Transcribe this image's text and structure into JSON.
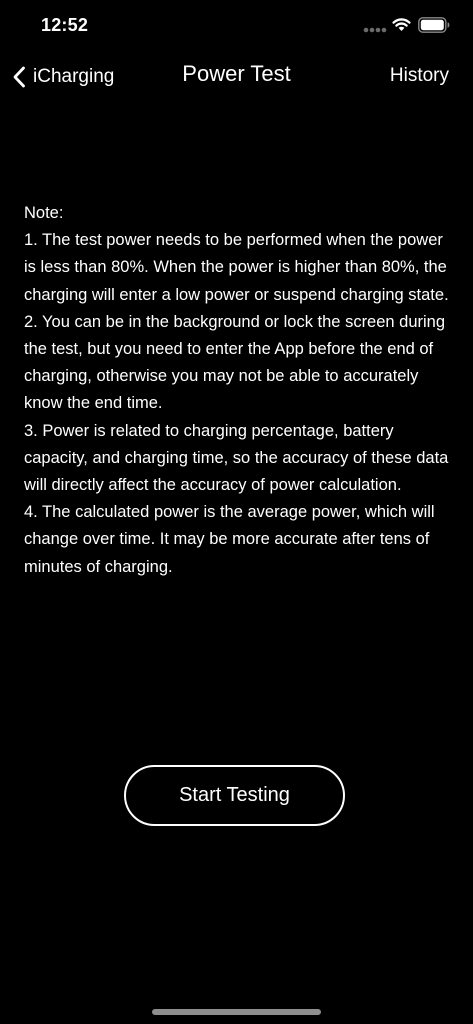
{
  "status_bar": {
    "time": "12:52"
  },
  "nav": {
    "back_label": "iCharging",
    "title": "Power Test",
    "history_label": "History"
  },
  "note": {
    "heading": "Note:",
    "items": [
      "1. The test power needs to be performed when the power is less than 80%. When the power is higher than 80%, the charging will enter a low power or suspend charging state.",
      "2. You can be in the background or lock the screen during the test, but you need to enter the App before the end of charging, otherwise you may not be able to accurately know the end time.",
      "3. Power is related to charging percentage, battery capacity, and charging time, so the accuracy of these data will directly affect the accuracy of power calculation.",
      "4. The calculated power is the average power, which will change over time. It may be more accurate after tens of minutes of charging."
    ]
  },
  "actions": {
    "start_label": "Start Testing"
  },
  "icons": {
    "back": "chevron-left-icon",
    "signal": "cellular-signal-icon",
    "wifi": "wifi-icon",
    "battery": "battery-icon"
  },
  "colors": {
    "background": "#000000",
    "foreground": "#ffffff",
    "home_indicator": "#8e8e8e"
  }
}
